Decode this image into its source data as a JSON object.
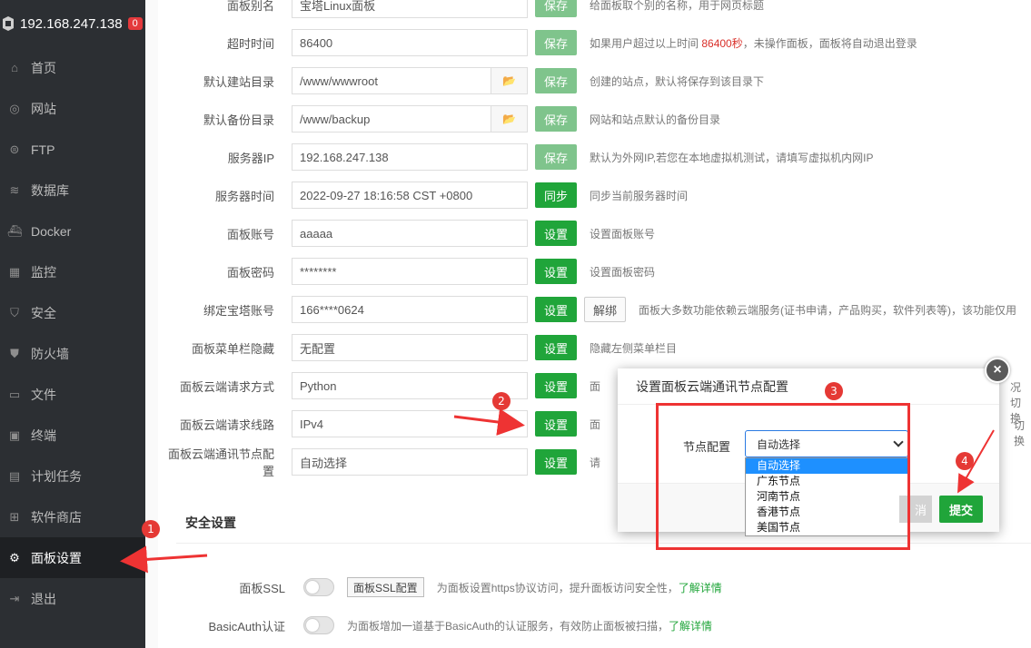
{
  "sidebar": {
    "server_ip": "192.168.247.138",
    "badge": "0",
    "items": [
      {
        "label": "首页",
        "icon": "home-icon"
      },
      {
        "label": "网站",
        "icon": "globe-icon"
      },
      {
        "label": "FTP",
        "icon": "ftp-icon"
      },
      {
        "label": "数据库",
        "icon": "database-icon"
      },
      {
        "label": "Docker",
        "icon": "docker-icon"
      },
      {
        "label": "监控",
        "icon": "monitor-icon"
      },
      {
        "label": "安全",
        "icon": "shield-icon"
      },
      {
        "label": "防火墙",
        "icon": "firewall-icon"
      },
      {
        "label": "文件",
        "icon": "folder-icon"
      },
      {
        "label": "终端",
        "icon": "terminal-icon"
      },
      {
        "label": "计划任务",
        "icon": "calendar-icon"
      },
      {
        "label": "软件商店",
        "icon": "store-icon"
      },
      {
        "label": "面板设置",
        "icon": "gear-icon",
        "active": true
      },
      {
        "label": "退出",
        "icon": "logout-icon"
      }
    ]
  },
  "settings": {
    "alias": {
      "label": "面板别名",
      "value": "宝塔Linux面板",
      "btn": "保存",
      "hint": "给面板取个别的名称，用于网页标题"
    },
    "timeout": {
      "label": "超时时间",
      "value": "86400",
      "btn": "保存",
      "hint_a": "如果用户超过以上时间 ",
      "hint_red": "86400秒",
      "hint_b": "，未操作面板，面板将自动退出登录"
    },
    "site_dir": {
      "label": "默认建站目录",
      "value": "/www/wwwroot",
      "btn": "保存",
      "hint": "创建的站点，默认将保存到该目录下"
    },
    "backup_dir": {
      "label": "默认备份目录",
      "value": "/www/backup",
      "btn": "保存",
      "hint": "网站和站点默认的备份目录"
    },
    "server_ip": {
      "label": "服务器IP",
      "value": "192.168.247.138",
      "btn": "保存",
      "hint": "默认为外网IP,若您在本地虚拟机测试，请填写虚拟机内网IP"
    },
    "server_time": {
      "label": "服务器时间",
      "value": "2022-09-27 18:16:58 CST +0800",
      "btn": "同步",
      "hint": "同步当前服务器时间"
    },
    "account": {
      "label": "面板账号",
      "value": "aaaaa",
      "btn": "设置",
      "hint": "设置面板账号"
    },
    "password": {
      "label": "面板密码",
      "value": "********",
      "btn": "设置",
      "hint": "设置面板密码"
    },
    "bt_account": {
      "label": "绑定宝塔账号",
      "value": "166****0624",
      "btn": "设置",
      "btn2": "解绑",
      "hint": "面板大多数功能依赖云端服务(证书申请，产品购买，软件列表等)，该功能仅用"
    },
    "menu_hide": {
      "label": "面板菜单栏隐藏",
      "value": "无配置",
      "btn": "设置",
      "hint": "隐藏左侧菜单栏目"
    },
    "cloud_method": {
      "label": "面板云端请求方式",
      "value": "Python",
      "btn": "设置",
      "hint": "面",
      "hint_right": "况切换"
    },
    "cloud_line": {
      "label": "面板云端请求线路",
      "value": "IPv4",
      "btn": "设置",
      "hint": "面",
      "hint_right": "切换"
    },
    "cloud_node": {
      "label": "面板云端通讯节点配置",
      "value": "自动选择",
      "btn": "设置",
      "hint": "请"
    }
  },
  "security": {
    "title": "安全设置",
    "ssl": {
      "label": "面板SSL",
      "btn": "面板SSL配置",
      "hint": "为面板设置https协议访问，提升面板访问安全性，",
      "link": "了解详情"
    },
    "basicauth": {
      "label": "BasicAuth认证",
      "hint": "为面板增加一道基于BasicAuth的认证服务，有效防止面板被扫描，",
      "link": "了解详情"
    }
  },
  "dialog": {
    "title": "设置面板云端通讯节点配置",
    "field_label": "节点配置",
    "selected": "自动选择",
    "options": [
      "自动选择",
      "广东节点",
      "河南节点",
      "香港节点",
      "美国节点"
    ],
    "cancel": "消",
    "submit": "提交",
    "close": "×"
  },
  "annotations": [
    "1",
    "2",
    "3",
    "4"
  ],
  "colors": {
    "accent": "#20a53a",
    "sidebar": "#2c2f33",
    "annotation": "#e53935"
  }
}
